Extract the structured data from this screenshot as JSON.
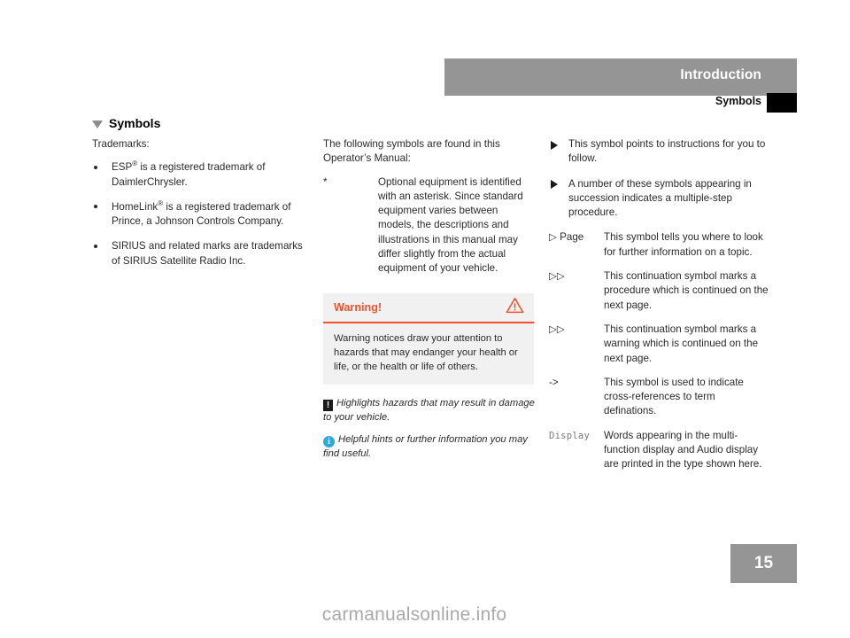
{
  "header": {
    "title": "Introduction",
    "subtitle": "Symbols",
    "bar_color": "#959595",
    "tab_color": "#000000"
  },
  "section": {
    "marker_icon": "triangle-down-icon",
    "title": "Symbols"
  },
  "left_column": {
    "intro": "Trademarks:",
    "bullets": [
      {
        "pre": "ESP",
        "sup": "®",
        "post": " is a registered trademark of DaimlerChrysler."
      },
      {
        "pre": "HomeLink",
        "sup": "®",
        "post": " is a registered trademark of Prince, a Johnson Controls Company."
      },
      {
        "pre": "SIRIUS and related marks are trademarks of SIRIUS Satellite Radio Inc.",
        "sup": "",
        "post": ""
      }
    ]
  },
  "middle_column": {
    "intro": "The following symbols are found in this Operator’s Manual:",
    "definitions": [
      {
        "symbol": "*",
        "text": "Optional equipment is identified with an asterisk. Since standard equipment varies between models, the descriptions and illustrations in this manual may differ slightly from the actual equipment of your vehicle."
      }
    ],
    "warning_box": {
      "title": "Warning!",
      "icon": "warning-triangle-icon",
      "icon_color": "#f4502c",
      "accent_color": "#f4502c",
      "background": "#f1f1f1",
      "body": "Warning notices draw your attention to hazards that may endanger your health or life, or the health or life of others."
    },
    "notes": [
      {
        "icon": "damage-exclamation-icon",
        "icon_glyph": "!",
        "icon_color": "#1a1a1a",
        "text": "Highlights hazards that may result in damage to your vehicle."
      },
      {
        "icon": "info-circle-icon",
        "icon_glyph": "i",
        "icon_color": "#2ea8dd",
        "text": "Helpful hints or further information you may find useful."
      }
    ]
  },
  "right_column": {
    "arrow_items": [
      "This symbol points to instructions for you to follow.",
      "A number of these symbols appearing in succession indicates a multiple-step procedure."
    ],
    "definitions": [
      {
        "symbol": "▷ Page",
        "style": "hollow",
        "text": "This symbol tells you where to look for further information on a topic."
      },
      {
        "symbol": "▷▷",
        "style": "hollow",
        "text": "This continuation symbol marks a procedure which is continued on the next page."
      },
      {
        "symbol": "▷▷",
        "style": "hollow-red",
        "text": "This continuation symbol marks a warning which is continued on the next page."
      },
      {
        "symbol": "->",
        "style": "plain",
        "text": "This symbol is used to indicate cross-references to term definations."
      },
      {
        "symbol": "Display",
        "style": "mono",
        "text": "Words appearing in the multi-function display and Audio display are printed in the type shown here."
      }
    ]
  },
  "footer": {
    "page_number": "15",
    "page_box_color": "#959595",
    "watermark": "carmanualsonline.info"
  }
}
